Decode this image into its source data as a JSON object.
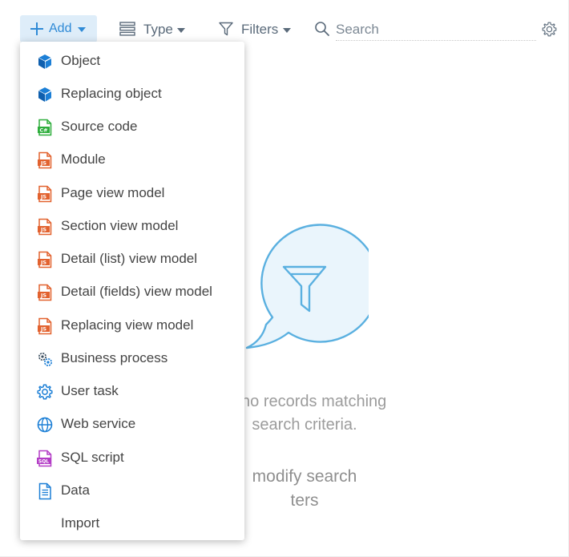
{
  "toolbar": {
    "add_label": "Add",
    "type_label": "Type",
    "filters_label": "Filters",
    "search_placeholder": "Search"
  },
  "menu": {
    "items": [
      {
        "label": "Object",
        "icon": "object-cube-icon"
      },
      {
        "label": "Replacing object",
        "icon": "replacing-object-cube-icon"
      },
      {
        "label": "Source code",
        "icon": "csharp-file-icon"
      },
      {
        "label": "Module",
        "icon": "js-file-icon"
      },
      {
        "label": "Page view model",
        "icon": "js-file-icon"
      },
      {
        "label": "Section view model",
        "icon": "js-file-icon"
      },
      {
        "label": "Detail (list) view model",
        "icon": "js-file-icon"
      },
      {
        "label": "Detail (fields) view model",
        "icon": "js-file-icon"
      },
      {
        "label": "Replacing view model",
        "icon": "js-file-icon"
      },
      {
        "label": "Business process",
        "icon": "business-process-gears-icon"
      },
      {
        "label": "User task",
        "icon": "user-task-gear-icon"
      },
      {
        "label": "Web service",
        "icon": "web-service-globe-icon"
      },
      {
        "label": "SQL script",
        "icon": "sql-file-icon"
      },
      {
        "label": "Data",
        "icon": "data-document-icon"
      },
      {
        "label": "Import",
        "icon": ""
      }
    ]
  },
  "empty_state": {
    "message_line1": "re no records matching",
    "message_line2": "search criteria.",
    "hint_line1": "modify search",
    "hint_line2": "ters"
  },
  "colors": {
    "accent": "#2f8ad6",
    "add_button_bg": "#deedf9",
    "toolbar_text": "#5a6a7a",
    "illustration": "#5ab0e0",
    "illustration_fill": "#eaf5fc",
    "js_icon": "#e2622f",
    "csharp_icon": "#2eae3c",
    "sql_icon": "#b33dc6"
  }
}
